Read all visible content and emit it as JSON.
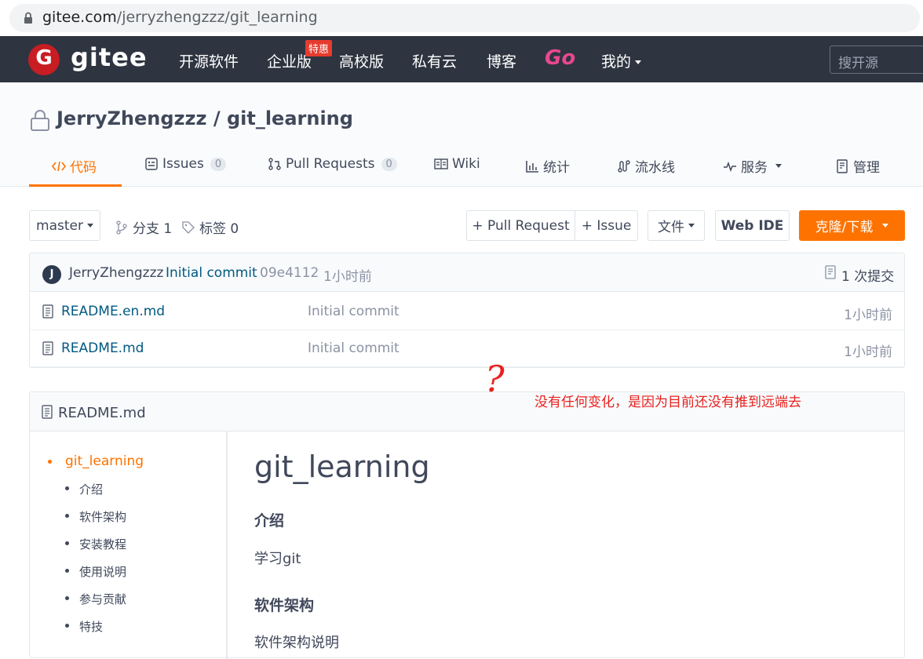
{
  "browser": {
    "url_host": "gitee.com",
    "url_path": "/jerryzhengzzz/git_learning"
  },
  "nav": {
    "logo_text": "gitee",
    "items": [
      "开源软件",
      "企业版",
      "高校版",
      "私有云",
      "博客"
    ],
    "badge": "特惠",
    "go": "Go",
    "mine": "我的",
    "search_placeholder": "搜开源"
  },
  "repo": {
    "title": "JerryZhengzzz / git_learning",
    "tabs": {
      "code": "代码",
      "issues": "Issues",
      "issues_count": "0",
      "pulls": "Pull Requests",
      "pulls_count": "0",
      "wiki": "Wiki",
      "stats": "统计",
      "pipeline": "流水线",
      "service": "服务",
      "manage": "管理"
    }
  },
  "toolbar": {
    "branch": "master",
    "branches": "分支 1",
    "tags": "标签 0",
    "pull_request": "+ Pull Request",
    "issue": "+ Issue",
    "file": "文件",
    "webide": "Web IDE",
    "clone": "克隆/下载"
  },
  "commit": {
    "avatar": "J",
    "author": "JerryZhengzzz",
    "message": "Initial commit",
    "hash": "09e4112",
    "time": "1小时前",
    "count": "1 次提交"
  },
  "files": [
    {
      "name": "README.en.md",
      "message": "Initial commit",
      "time": "1小时前"
    },
    {
      "name": "README.md",
      "message": "Initial commit",
      "time": "1小时前"
    }
  ],
  "annotation": {
    "mark": "?",
    "text": "没有任何变化，是因为目前还没有推到远端去"
  },
  "readme": {
    "filename": "README.md",
    "toc": [
      "git_learning",
      "介绍",
      "软件架构",
      "安装教程",
      "使用说明",
      "参与贡献",
      "特技"
    ],
    "h1": "git_learning",
    "intro_h": "介绍",
    "intro_p": "学习git",
    "arch_h": "软件架构",
    "arch_p": "软件架构说明"
  },
  "colors": {
    "accent": "#fe7300",
    "nav_bg": "#2e3440",
    "link": "#005980",
    "annotation": "#e8221f"
  }
}
